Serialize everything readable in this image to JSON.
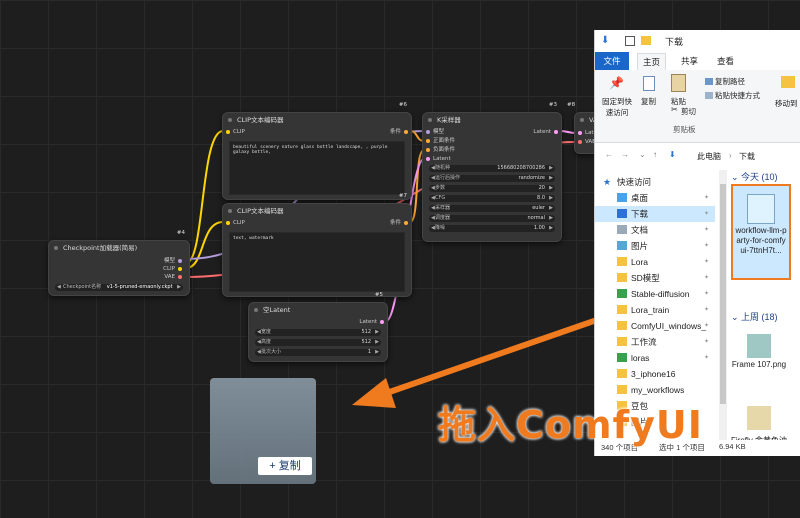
{
  "nodes": {
    "checkpoint": {
      "badge": "#4",
      "title": "Checkpoint加载器(简易)",
      "outputs": [
        "模型",
        "CLIP",
        "VAE"
      ],
      "widget_label": "Checkpoint名称",
      "widget_value": "v1-5-pruned-emaonly.ckpt"
    },
    "clip_pos": {
      "badge": "#6",
      "title": "CLIP文本编码器",
      "input": "CLIP",
      "output": "条件",
      "text": "beautiful scenery nature glass bottle landscape, , purple galaxy bottle,"
    },
    "clip_neg": {
      "badge": "#7",
      "title": "CLIP文本编码器",
      "input": "CLIP",
      "output": "条件",
      "text": "text, watermark"
    },
    "ksampler": {
      "badge": "#3",
      "title": "K采样器",
      "inputs": [
        "模型",
        "正面条件",
        "负面条件",
        "Latent"
      ],
      "output": "Latent",
      "widgets": [
        {
          "label": "随机种",
          "value": "156680208700286"
        },
        {
          "label": "运行后操作",
          "value": "randomize"
        },
        {
          "label": "步数",
          "value": "20"
        },
        {
          "label": "CFG",
          "value": "8.0"
        },
        {
          "label": "采样器",
          "value": "euler"
        },
        {
          "label": "调度器",
          "value": "normal"
        },
        {
          "label": "降噪",
          "value": "1.00"
        }
      ]
    },
    "latent": {
      "badge": "#5",
      "title": "空Latent",
      "output": "Latent",
      "widgets": [
        {
          "label": "宽度",
          "value": "512"
        },
        {
          "label": "高度",
          "value": "512"
        },
        {
          "label": "批次大小",
          "value": "1"
        }
      ]
    },
    "vae_partial": {
      "title": "VA",
      "inputs": [
        "Laten",
        "VAE"
      ],
      "badge": "#8"
    }
  },
  "drop": {
    "label": "+ 复制",
    "overlay_text": "拖入ComfyUI"
  },
  "explorer": {
    "title": "下载",
    "tabs": [
      "文件",
      "主页",
      "共享",
      "查看"
    ],
    "ribbon": {
      "pin": "固定到快速访问",
      "copy": "复制",
      "paste": "粘贴",
      "copy_path": "复制路径",
      "paste_shortcut": "粘贴快捷方式",
      "cut": "剪切",
      "clipboard": "剪贴板",
      "move_to": "移动到"
    },
    "address": [
      "此电脑",
      "下载"
    ],
    "nav_items": [
      {
        "label": "快速访问",
        "icon": "star-icon"
      },
      {
        "label": "桌面",
        "icon": "folder-blue-icon",
        "pinned": true
      },
      {
        "label": "下载",
        "icon": "download-folder-icon",
        "pinned": true,
        "selected": true
      },
      {
        "label": "文档",
        "icon": "document-folder-icon",
        "pinned": true
      },
      {
        "label": "图片",
        "icon": "pictures-folder-icon",
        "pinned": true
      },
      {
        "label": "Lora",
        "icon": "folder-icon",
        "pinned": true
      },
      {
        "label": "SD模型",
        "icon": "folder-icon",
        "pinned": true
      },
      {
        "label": "Stable-diffusion",
        "icon": "folder-green-icon",
        "pinned": true
      },
      {
        "label": "Lora_train",
        "icon": "folder-icon",
        "pinned": true
      },
      {
        "label": "ComfyUI_windows_",
        "icon": "folder-icon",
        "pinned": true
      },
      {
        "label": "工作流",
        "icon": "folder-icon",
        "pinned": true
      },
      {
        "label": "loras",
        "icon": "folder-green-icon",
        "pinned": true
      },
      {
        "label": "3_iphone16",
        "icon": "folder-icon",
        "pinned": false
      },
      {
        "label": "my_workflows",
        "icon": "folder-icon",
        "pinned": false
      },
      {
        "label": "豆包",
        "icon": "folder-icon",
        "pinned": false
      },
      {
        "label": "图片",
        "icon": "folder-icon",
        "pinned": false
      }
    ],
    "groups": [
      {
        "label": "今天 (10)",
        "files": [
          {
            "name": "workflow-llm-party-for-comfyui-7ttnH7t...",
            "selected": true
          }
        ]
      },
      {
        "label": "上周 (18)",
        "files": [
          {
            "name": "Frame 107.png"
          },
          {
            "name": "Firefly 金黄色油漆相"
          }
        ]
      }
    ],
    "status": {
      "count": "340 个项目",
      "selected": "选中 1 个项目",
      "size": "6.94 KB"
    }
  },
  "colors": {
    "arrow": "#f07a1e",
    "clip_wire": "#ffd500",
    "model_wire": "#b39ddb",
    "vae_wire": "#ff6e6e",
    "cond_wire": "#ffa931",
    "latent_wire": "#ff9cf9"
  }
}
